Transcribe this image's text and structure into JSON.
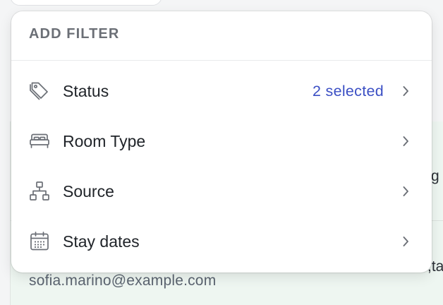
{
  "background": {
    "email": "sofia.marino@example.com",
    "right_fragment_1": "g",
    "right_fragment_2": ",ta"
  },
  "filter_menu": {
    "title": "ADD FILTER",
    "items": [
      {
        "label": "Status",
        "value": "2 selected",
        "icon": "tag-icon"
      },
      {
        "label": "Room Type",
        "value": "",
        "icon": "bed-icon"
      },
      {
        "label": "Source",
        "value": "",
        "icon": "sitemap-icon"
      },
      {
        "label": "Stay dates",
        "value": "",
        "icon": "calendar-icon"
      }
    ]
  },
  "colors": {
    "accent": "#3b4fc4",
    "icon": "#6b6f76",
    "title": "#6b6f76",
    "text": "#1f2328"
  }
}
